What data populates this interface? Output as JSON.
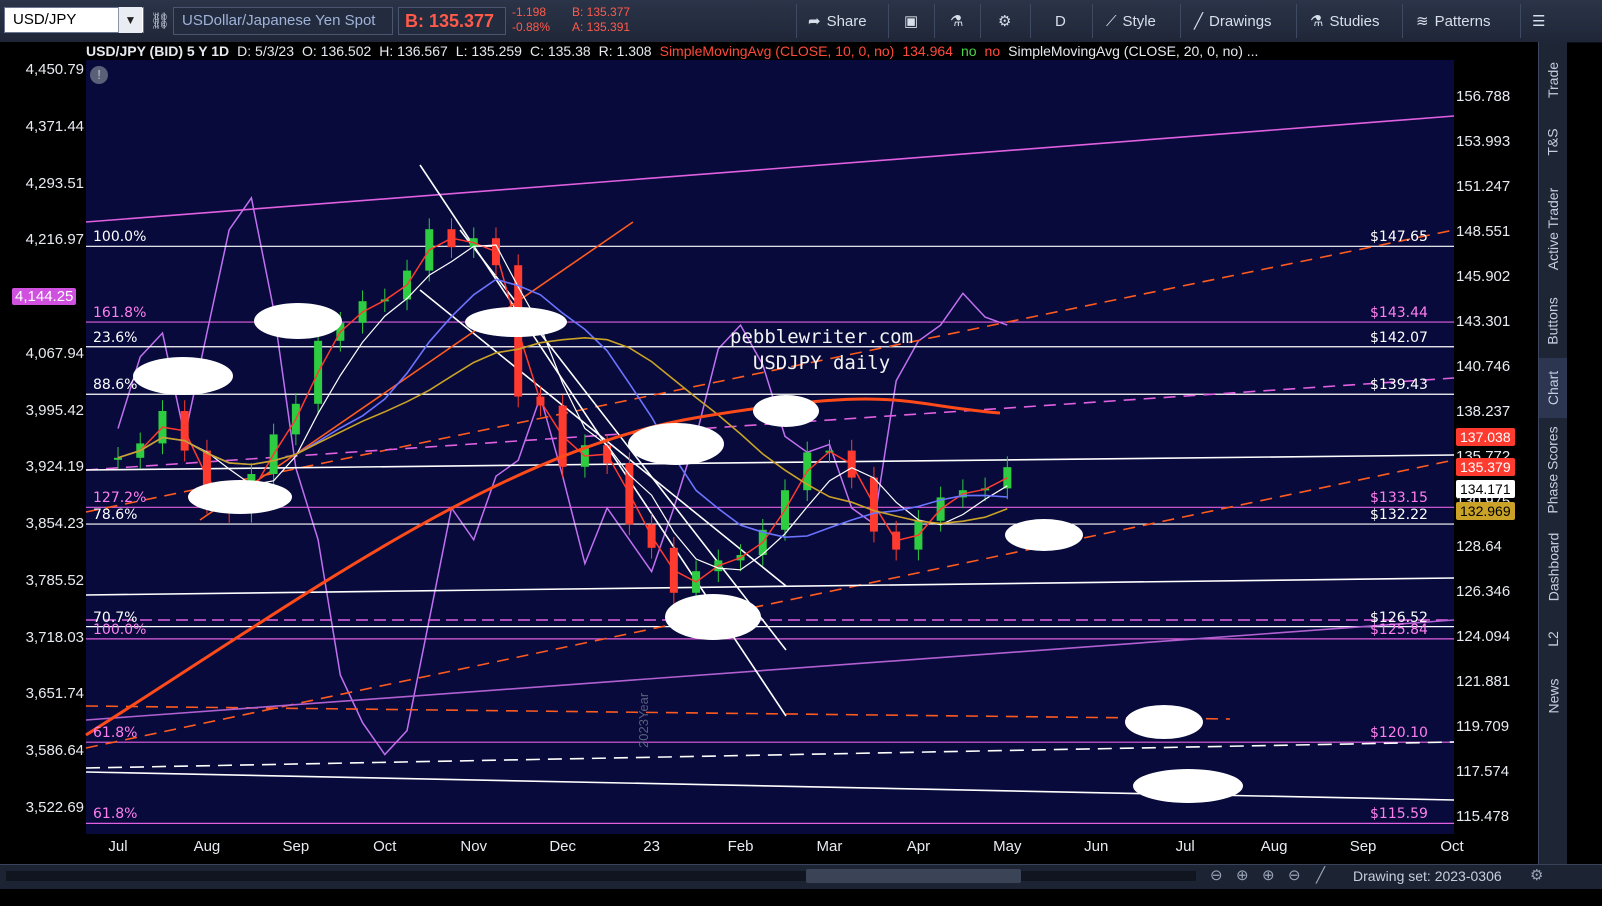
{
  "toolbar": {
    "symbol": "USD/JPY",
    "description": "USDollar/Japanese Yen Spot",
    "last_quote": "B: 135.377",
    "change": "-1.198",
    "change_pct": "-0.88%",
    "bid": "B: 135.377",
    "ask": "A: 135.391",
    "share_label": "Share",
    "period_label": "D",
    "style_label": "Style",
    "drawings_label": "Drawings",
    "studies_label": "Studies",
    "patterns_label": "Patterns"
  },
  "infobar": {
    "title": "USD/JPY (BID) 5 Y 1D",
    "date": "D: 5/3/23",
    "open": "O: 136.502",
    "high": "H: 136.567",
    "low": "L: 135.259",
    "close": "C: 135.38",
    "range": "R: 1.308",
    "sma10": "SimpleMovingAvg (CLOSE, 10, 0, no)",
    "sma10_val": "134.964",
    "no1": "no",
    "no2": "no",
    "sma20": "SimpleMovingAvg (CLOSE, 20, 0, no) ..."
  },
  "right_tabs": [
    "Trade",
    "T&S",
    "Active Trader",
    "Buttons",
    "Chart",
    "Phase Scores",
    "Dashboard",
    "L2",
    "News"
  ],
  "bottom": {
    "drawing_set": "Drawing set: 2023-0306"
  },
  "watermark": [
    "pebblewriter.com",
    "USDJPY daily"
  ],
  "year_marker": "2023Year",
  "colors": {
    "background": "#070a3a",
    "up_candle": "#2ecc40",
    "down_candle": "#ff3b30",
    "sma10": "#ff3b30",
    "sma20": "#ffffff",
    "sma50": "#6b73ff",
    "sma100": "#c9a227",
    "sma200": "#ff4a1a",
    "overlay_index": "#c070f0",
    "fib_lines": "#ffffff",
    "fib_pink": "#e060e0",
    "trend_orange": "#ff5a1f"
  },
  "chart_data": {
    "type": "candlestick",
    "x_axis": {
      "tick_labels": [
        "Jul",
        "Aug",
        "Sep",
        "Oct",
        "Nov",
        "Dec",
        "23",
        "Feb",
        "Mar",
        "Apr",
        "May",
        "Jun",
        "Jul",
        "Aug",
        "Sep",
        "Oct"
      ]
    },
    "left_axis": {
      "tick_labels": [
        "4,450.79",
        "4,371.44",
        "4,293.51",
        "4,216.97",
        "4,144.25",
        "4,067.94",
        "3,995.42",
        "3,924.19",
        "3,854.23",
        "3,785.52",
        "3,718.03",
        "3,651.74",
        "3,586.64",
        "3,522.69"
      ],
      "highlight": "4,144.25"
    },
    "right_axis": {
      "tick_labels": [
        "156.788",
        "153.993",
        "151.247",
        "148.551",
        "145.902",
        "143.301",
        "140.746",
        "138.237",
        "135.772",
        "130.975",
        "128.64",
        "126.346",
        "124.094",
        "121.881",
        "119.709",
        "117.574",
        "115.478"
      ],
      "ylim": [
        115.0,
        158.0
      ]
    },
    "price_series": {
      "name": "USD/JPY",
      "dates": [
        "Jul",
        "Jul",
        "Jul",
        "Jul",
        "Aug",
        "Aug",
        "Aug",
        "Aug",
        "Sep",
        "Sep",
        "Sep",
        "Sep",
        "Oct",
        "Oct",
        "Oct",
        "Oct",
        "Nov",
        "Nov",
        "Nov",
        "Nov",
        "Dec",
        "Dec",
        "Dec",
        "Dec",
        "Jan",
        "Jan",
        "Jan",
        "Jan",
        "Feb",
        "Feb",
        "Feb",
        "Feb",
        "Mar",
        "Mar",
        "Mar",
        "Mar",
        "Apr",
        "Apr",
        "Apr",
        "Apr",
        "May"
      ],
      "close": [
        135.9,
        136.7,
        138.5,
        136.3,
        133.4,
        132.9,
        135.0,
        137.2,
        138.9,
        142.4,
        143.4,
        144.6,
        144.7,
        146.3,
        148.6,
        147.6,
        148.1,
        146.6,
        139.3,
        138.8,
        135.4,
        136.6,
        135.6,
        132.2,
        130.9,
        128.4,
        129.6,
        130.2,
        130.5,
        131.9,
        134.1,
        136.2,
        136.3,
        134.8,
        131.8,
        130.8,
        132.4,
        133.7,
        134.1,
        134.2,
        135.38
      ]
    },
    "overlay_index_series": {
      "values": [
        4000,
        4090,
        4120,
        3990,
        4120,
        4250,
        4290,
        4150,
        3950,
        3860,
        3690,
        3630,
        3590,
        3620,
        3760,
        3900,
        3860,
        3940,
        3960,
        4040,
        3940,
        3830,
        3900,
        3860,
        3820,
        3900,
        3990,
        4100,
        4130,
        4080,
        3990,
        3970,
        3980,
        3900,
        3880,
        4060,
        4110,
        4130,
        4170,
        4140,
        4130
      ]
    },
    "moving_averages": [
      {
        "name": "SMA 10",
        "last": 134.96
      },
      {
        "name": "SMA 20",
        "last": 134.17
      },
      {
        "name": "SMA 200",
        "last": 137.03
      },
      {
        "name": "SMA 100",
        "last": 132.96
      }
    ],
    "fib_levels": [
      {
        "label": "100.0%",
        "price_label": "$147.65",
        "value": 147.65
      },
      {
        "label": "161.8%",
        "price_label": "$143.44",
        "value": 143.44
      },
      {
        "label": "23.6%",
        "price_label": "$142.07",
        "value": 142.07
      },
      {
        "label": "88.6%",
        "price_label": "$139.43",
        "value": 139.43
      },
      {
        "label": "127.2%",
        "price_label": "$133.15",
        "value": 133.15
      },
      {
        "label": "78.6%",
        "price_label": "$132.22",
        "value": 132.22
      },
      {
        "label": "70.7%",
        "price_label": "$126.52",
        "value": 126.52
      },
      {
        "label": "100.0%",
        "price_label": "$125.84",
        "value": 125.84
      },
      {
        "label": "61.8%",
        "price_label": "$120.10",
        "value": 120.1
      },
      {
        "label": "61.8%",
        "price_label": "$115.59",
        "value": 115.59
      }
    ],
    "price_tags": [
      {
        "text": "137.038",
        "value": 137.03,
        "bg": "#ff3b30",
        "fg": "#ffffff"
      },
      {
        "text": "135.379",
        "value": 135.38,
        "bg": "#ff3b30",
        "fg": "#ffffff"
      },
      {
        "text": "134.171",
        "value": 134.17,
        "bg": "#ffffff",
        "fg": "#000000"
      },
      {
        "text": "132.969",
        "value": 132.96,
        "bg": "#c9a227",
        "fg": "#000000"
      }
    ]
  }
}
